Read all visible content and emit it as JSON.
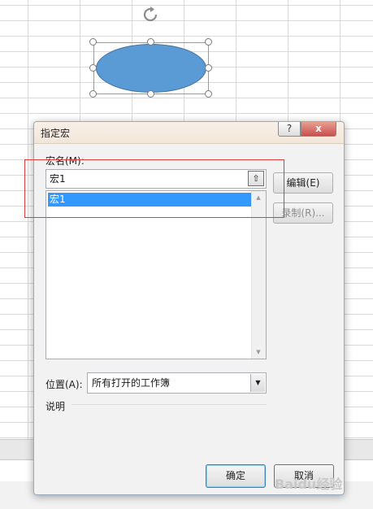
{
  "dialog": {
    "title": "指定宏",
    "help_label": "?",
    "close_label": "x",
    "macro_name_label": "宏名(M):",
    "macro_name_value": "宏1",
    "upload_glyph": "⇧",
    "macro_list": [
      "宏1"
    ],
    "edit_label": "编辑(E)",
    "record_label": "录制(R)...",
    "location_label": "位置(A):",
    "location_value": "所有打开的工作簿",
    "description_label": "说明",
    "ok_label": "确定",
    "cancel_label": "取消"
  },
  "watermark": "Baidu经验",
  "colors": {
    "shape_fill": "#5b9bd5",
    "highlight": "#e03c3c",
    "selected_row": "#3399ff"
  },
  "icons": {
    "rotate": "rotate-handle-icon",
    "help": "help-icon",
    "close": "close-icon",
    "upload": "upload-icon",
    "dropdown": "chevron-down-icon"
  }
}
